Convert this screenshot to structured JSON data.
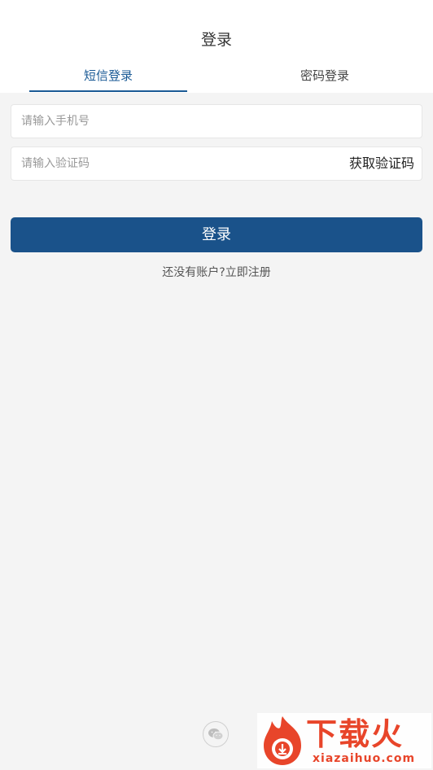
{
  "header": {
    "title": "登录"
  },
  "tabs": {
    "sms": "短信登录",
    "password": "密码登录"
  },
  "form": {
    "phone_placeholder": "请输入手机号",
    "code_placeholder": "请输入验证码",
    "get_code_label": "获取验证码",
    "login_label": "登录"
  },
  "register_link": "还没有账户?立即注册",
  "social": {
    "wechat_icon": "wechat-icon"
  },
  "watermark": {
    "cn_text": "下载火",
    "en_text": "xiazaihuo.com"
  },
  "colors": {
    "accent": "#1a5a95",
    "button": "#1a528a",
    "background": "#f4f4f4",
    "watermark": "#e8452a"
  }
}
